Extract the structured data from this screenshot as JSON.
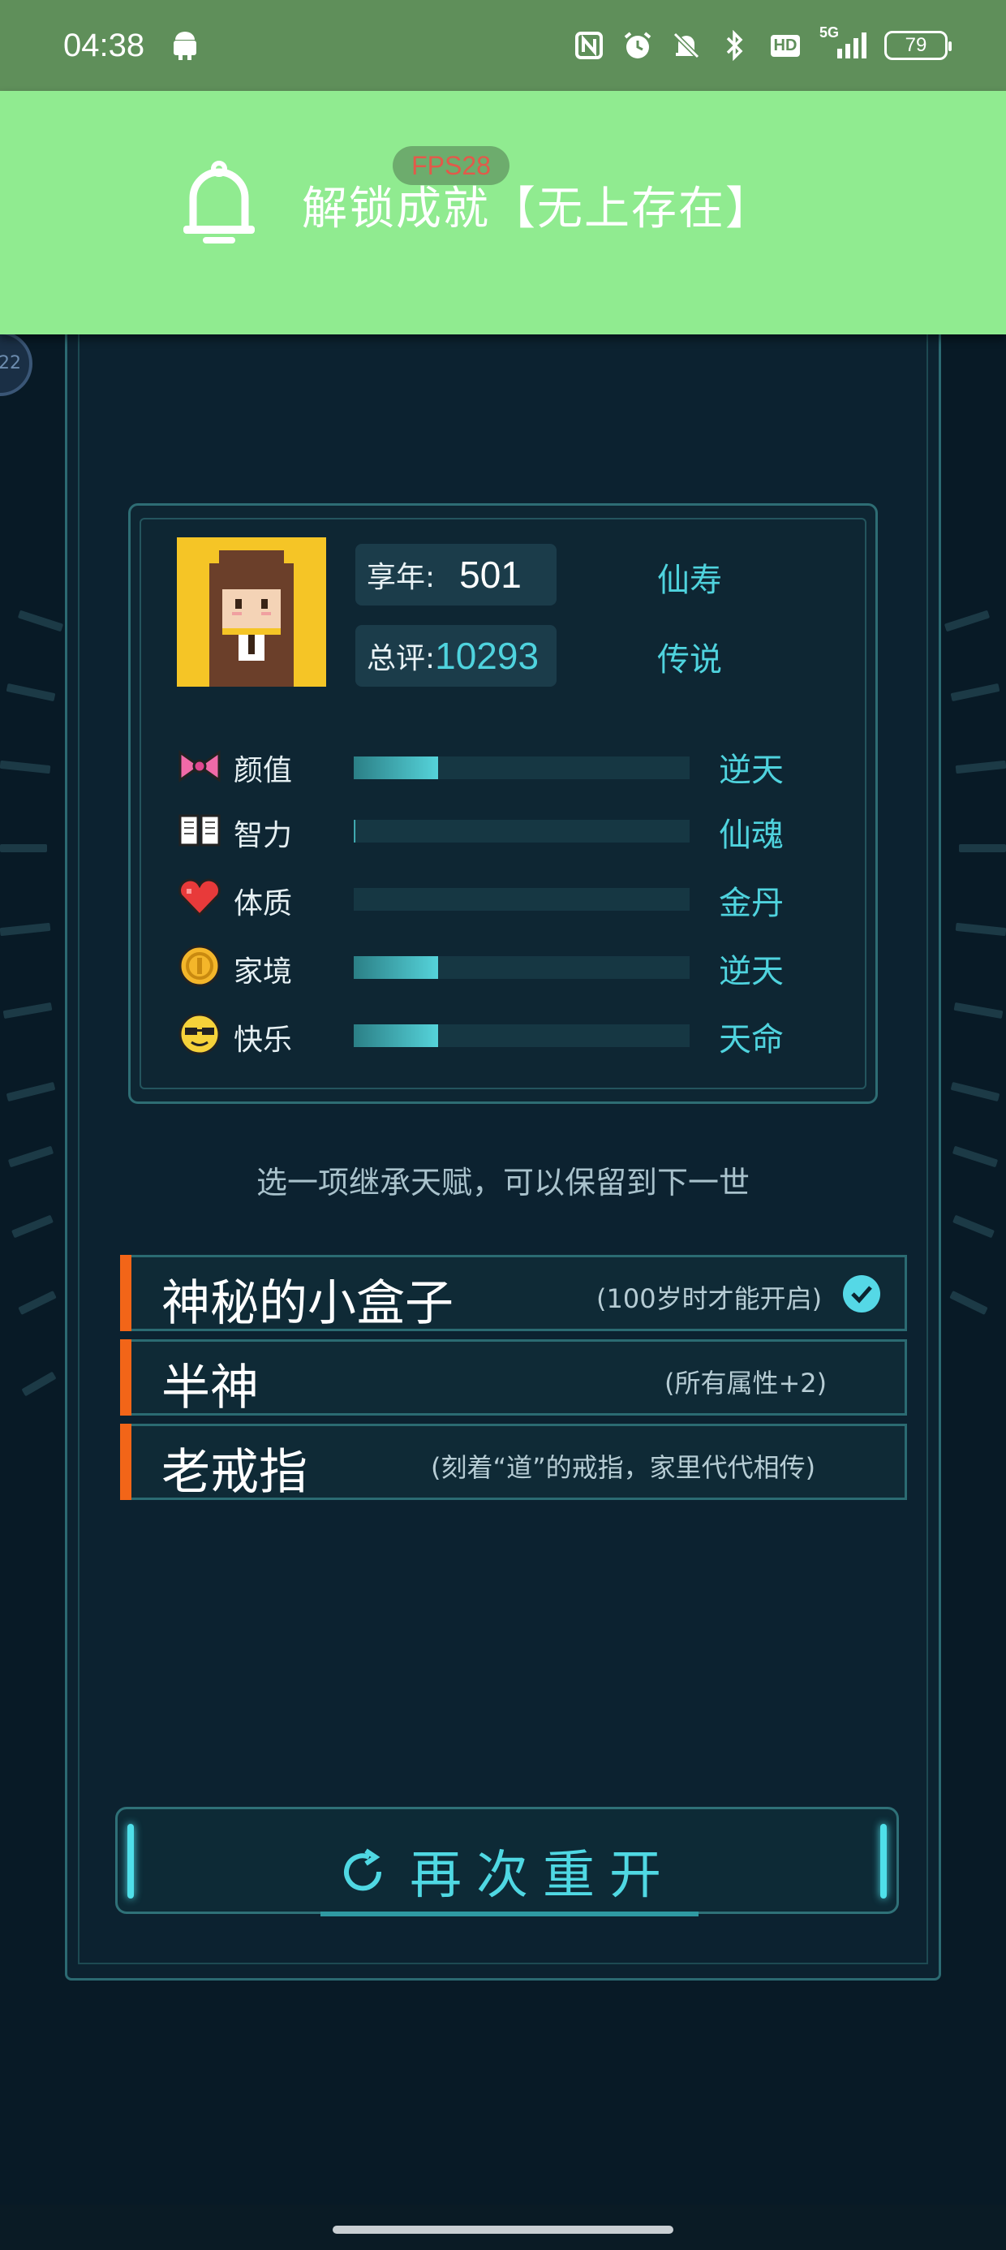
{
  "status_bar": {
    "time": "04:38",
    "icons": [
      "android-icon",
      "nfc-icon",
      "alarm-icon",
      "mute-bell-icon",
      "bluetooth-icon",
      "hd-icon",
      "5g-signal-icon",
      "battery-icon"
    ],
    "hd": "HD",
    "network": "5G",
    "battery": "79"
  },
  "notification": {
    "fps": "FPS28",
    "icon": "bell-icon",
    "text": "解锁成就【无上存在】"
  },
  "side_bubble": "22",
  "summary": {
    "age_label": "享年:",
    "age_value": "501",
    "age_rank": "仙寿",
    "score_label": "总评:",
    "score_value": "10293",
    "score_rank": "传说"
  },
  "attributes": [
    {
      "icon": "bow-icon",
      "label": "颜值",
      "fill": 0.25,
      "tier": "逆天"
    },
    {
      "icon": "book-icon",
      "label": "智力",
      "fill": 0.0,
      "tier": "仙魂"
    },
    {
      "icon": "heart-icon",
      "label": "体质",
      "fill": 0.0,
      "tier": "金丹"
    },
    {
      "icon": "coin-icon",
      "label": "家境",
      "fill": 0.25,
      "tier": "逆天"
    },
    {
      "icon": "sunglasses-face-icon",
      "label": "快乐",
      "fill": 0.25,
      "tier": "天命"
    }
  ],
  "hint": "选一项继承天赋，可以保留到下一世",
  "talents": [
    {
      "name": "神秘的小盒子",
      "desc": "(100岁时才能开启)",
      "selected": true
    },
    {
      "name": "半神",
      "desc": "(所有属性+2)",
      "selected": false
    },
    {
      "name": "老戒指",
      "desc": "(刻着“道”的戒指，家里代代相传)",
      "selected": false
    }
  ],
  "restart_label": "再次重开",
  "colors": {
    "accent": "#4fd3de",
    "notification_bg": "#90eb90",
    "status_bar_bg": "#5f8f5a",
    "talent_marker": "#f26518",
    "panel_bg": "#0e2633"
  }
}
